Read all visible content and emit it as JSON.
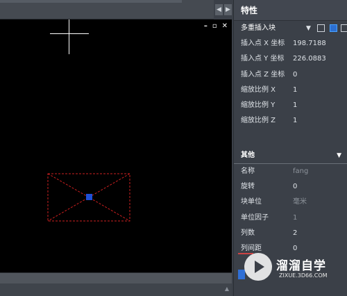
{
  "canvas": {
    "window_buttons": [
      "–",
      "▫",
      "✕"
    ]
  },
  "panel": {
    "title": "特性",
    "selector": "多重插入块",
    "geometry_rows": [
      {
        "label": "插入点 X 坐标",
        "value": "198.7188"
      },
      {
        "label": "插入点 Y 坐标",
        "value": "226.0883"
      },
      {
        "label": "插入点 Z 坐标",
        "value": "0"
      },
      {
        "label": "缩放比例 X",
        "value": "1"
      },
      {
        "label": "缩放比例 Y",
        "value": "1"
      },
      {
        "label": "缩放比例 Z",
        "value": "1"
      }
    ],
    "other_section": "其他",
    "other_rows": [
      {
        "label": "名称",
        "value": "fang",
        "dim": true
      },
      {
        "label": "旋转",
        "value": "0",
        "dim": false
      },
      {
        "label": "块单位",
        "value": "毫米",
        "dim": true
      },
      {
        "label": "单位因子",
        "value": "1",
        "dim": true
      },
      {
        "label": "列数",
        "value": "2",
        "dim": false
      },
      {
        "label": "列间距",
        "value": "0",
        "dim": false
      }
    ]
  },
  "watermark": {
    "title": "溜溜自学",
    "url": "ZIXUE.3D66.COM"
  },
  "colors": {
    "canvas_bg": "#000000",
    "panel_bg": "#3b4048",
    "block_outline": "#cc1f1f",
    "grip": "#1f4fd6"
  }
}
